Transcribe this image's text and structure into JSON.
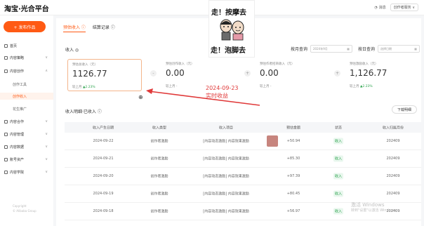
{
  "header": {
    "logo": "淘宝·光合平台",
    "message": "消息",
    "service": "创作者服务 ∨"
  },
  "sidebar": {
    "publish": "+ 发布作品",
    "items": [
      {
        "label": "首页",
        "icon": "home-icon"
      },
      {
        "label": "内容策略",
        "icon": "strategy-icon"
      },
      {
        "label": "内容创作",
        "icon": "create-icon"
      },
      {
        "label": "创作工具",
        "sub": true
      },
      {
        "label": "创作收入",
        "sub": true,
        "active": true
      },
      {
        "label": "花生推广",
        "sub": true
      },
      {
        "label": "内容合作",
        "icon": "coop-icon"
      },
      {
        "label": "内容管理",
        "icon": "manage-icon"
      },
      {
        "label": "内容数据",
        "icon": "data-icon"
      },
      {
        "label": "账号资产",
        "icon": "asset-icon"
      },
      {
        "label": "内容学院",
        "icon": "school-icon"
      }
    ],
    "copyright": [
      "Copyright",
      "© Alibaba Group"
    ]
  },
  "tabs": [
    "预估收入 ⓘ",
    "结算记录 ⓘ"
  ],
  "overlay": {
    "line1": "走！按摩去",
    "line2": "走！泡脚去"
  },
  "income": {
    "title": "收入 ◎",
    "month_query": "按月查询",
    "month_value": "2024年9月",
    "day_query": "按日查询",
    "day_placeholder": "选择日期",
    "cards": [
      {
        "label": "预估总收入（元）",
        "value": "1126.77",
        "cmp": "较上月",
        "trend": "▲2.23%"
      },
      {
        "label": "预估创作收入（元）",
        "value": "0.00",
        "cmp": "较上月 -",
        "trend": ""
      },
      {
        "label": "预估作者招商收入（元）",
        "value": "0.00",
        "cmp": "较上月 -",
        "trend": ""
      },
      {
        "label": "预估激励收入（元）",
        "value": "1,126.77",
        "cmp": "较上月",
        "trend": "▲2.23%"
      }
    ],
    "sep_minus": "-",
    "sep_plus": "+"
  },
  "annotation": {
    "date": "2024-09-23",
    "text": "实时收益"
  },
  "detail": {
    "title": "收入明细·已收入 ⓘ",
    "download": "下载明细",
    "columns": [
      "收入产生日期",
      "收入类型",
      "收入项目",
      "预估金额",
      "状态",
      "收入归属月份"
    ],
    "rows": [
      {
        "date": "2024-09-22",
        "type": "创作者激励",
        "item": "[内容动态激励] 内容效果激励",
        "amount": "+50.94",
        "status": "收入",
        "month": "202409"
      },
      {
        "date": "2024-09-21",
        "type": "创作者激励",
        "item": "[内容动态激励] 内容效果激励",
        "amount": "+85.30",
        "status": "收入",
        "month": "202409"
      },
      {
        "date": "2024-09-20",
        "type": "创作者激励",
        "item": "[内容动态激励] 内容效果激励",
        "amount": "+97.39",
        "status": "收入",
        "month": "202409"
      },
      {
        "date": "2024-09-19",
        "type": "创作者激励",
        "item": "[内容动态激励] 内容效果激励",
        "amount": "+80.45",
        "status": "收入",
        "month": "202409"
      },
      {
        "date": "2024-09-18",
        "type": "创作者激励",
        "item": "[内容动态激励] 内容效果激励",
        "amount": "+56.97",
        "status": "收入",
        "month": "202409"
      }
    ]
  },
  "watermark": [
    "激活 Windows",
    "转到\"设置\"以激活 Windows。"
  ],
  "colors": {
    "accent": "#ff5a14",
    "annotation": "#e03a3a",
    "positive": "#2da44e"
  }
}
